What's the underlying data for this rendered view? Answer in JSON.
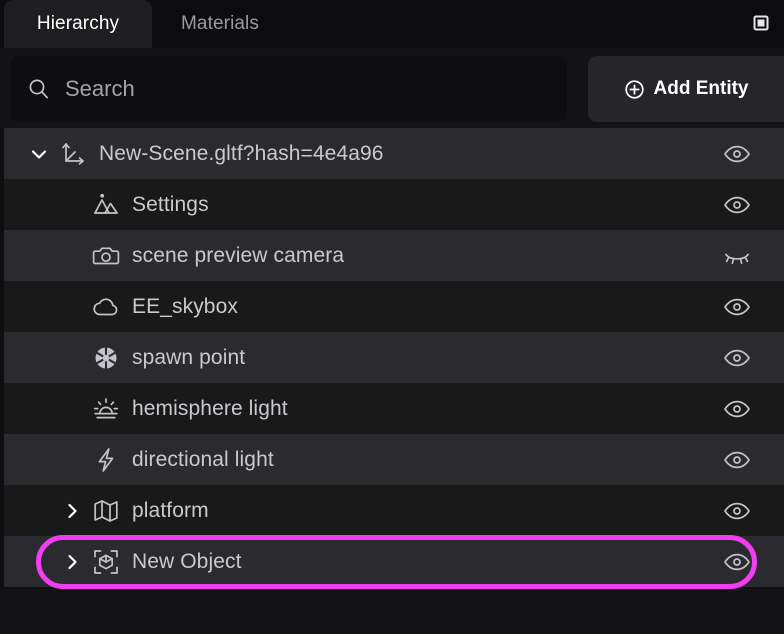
{
  "window": {
    "panel_icon": "panel-square-icon",
    "accent_color": "#f23ef2",
    "background": "#0e0e10"
  },
  "tabs": [
    {
      "id": "hierarchy",
      "label": "Hierarchy",
      "active": true
    },
    {
      "id": "materials",
      "label": "Materials",
      "active": false
    }
  ],
  "toolbar": {
    "search": {
      "icon": "search-icon",
      "value": "",
      "placeholder": "Search"
    },
    "add_entity": {
      "label": "Add Entity",
      "icon": "plus-circle-icon"
    }
  },
  "tree": {
    "rows": [
      {
        "label": "New-Scene.gltf?hash=4e4a96",
        "icon": "axes-transform-icon",
        "twisty": "chevron-down",
        "indent": 0,
        "visible": true,
        "eye_icon": "eye-open-icon",
        "selected": false,
        "highlighted": false
      },
      {
        "label": "Settings",
        "icon": "image-mountains-icon",
        "twisty": "none",
        "indent": 1,
        "visible": true,
        "eye_icon": "eye-open-icon",
        "selected": false,
        "highlighted": false
      },
      {
        "label": "scene preview camera",
        "icon": "camera-icon",
        "twisty": "none",
        "indent": 1,
        "visible": false,
        "eye_icon": "eye-closed-icon",
        "selected": false,
        "highlighted": false
      },
      {
        "label": "EE_skybox",
        "icon": "cloud-icon",
        "twisty": "none",
        "indent": 1,
        "visible": true,
        "eye_icon": "eye-open-icon",
        "selected": false,
        "highlighted": false
      },
      {
        "label": "spawn point",
        "icon": "aperture-icon",
        "twisty": "none",
        "indent": 1,
        "visible": true,
        "eye_icon": "eye-open-icon",
        "selected": false,
        "highlighted": false
      },
      {
        "label": "hemisphere light",
        "icon": "sunrise-icon",
        "twisty": "none",
        "indent": 1,
        "visible": true,
        "eye_icon": "eye-open-icon",
        "selected": false,
        "highlighted": false
      },
      {
        "label": "directional light",
        "icon": "lightning-bolt-icon",
        "twisty": "none",
        "indent": 1,
        "visible": true,
        "eye_icon": "eye-open-icon",
        "selected": false,
        "highlighted": false
      },
      {
        "label": "platform",
        "icon": "map-icon",
        "twisty": "chevron-right",
        "indent": 1,
        "visible": true,
        "eye_icon": "eye-open-icon",
        "selected": false,
        "highlighted": false
      },
      {
        "label": "New Object",
        "icon": "bounding-box-cube-icon",
        "twisty": "chevron-right",
        "indent": 1,
        "visible": true,
        "eye_icon": "eye-open-icon",
        "selected": true,
        "highlighted": true
      }
    ]
  }
}
